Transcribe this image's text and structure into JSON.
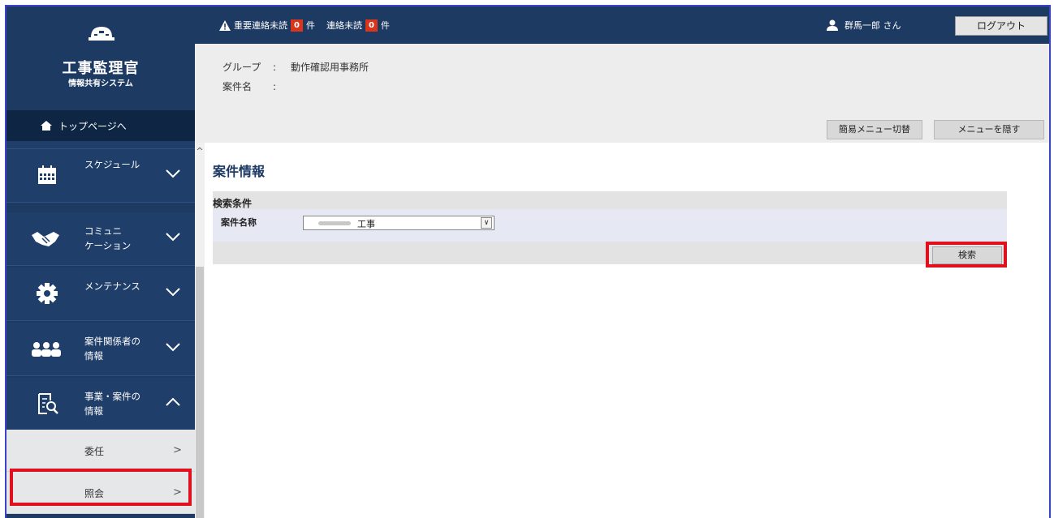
{
  "app": {
    "title": "工事監理官",
    "subtitle": "情報共有システム"
  },
  "sidebar": {
    "top_link": "トップページへ",
    "items": [
      {
        "label": "スケジュール"
      },
      {
        "label": "コミュニ\nケーション"
      },
      {
        "label": "メンテナンス"
      },
      {
        "label": "案件関係者の\n情報"
      },
      {
        "label": "事業・案件の\n情報"
      }
    ],
    "sub_items": [
      {
        "label": "委任"
      },
      {
        "label": "照会"
      }
    ]
  },
  "header": {
    "important_unread_label": "重要連絡未読",
    "important_unread_count": "0",
    "count_unit": "件",
    "unread_label": "連絡未読",
    "unread_count": "0",
    "user_name": "群馬一郎 さん",
    "logout": "ログアウト"
  },
  "info": {
    "group_label": "グループ",
    "group_value": "動作確認用事務所",
    "project_label": "案件名",
    "colon": ":",
    "simple_menu_button": "簡易メニュー切替",
    "hide_menu_button": "メニューを隠す"
  },
  "main": {
    "page_title": "案件情報",
    "search_conditions": "検索条件",
    "project_name_label": "案件名称",
    "project_name_value": "工事",
    "search_button": "検索"
  },
  "colors": {
    "navy": "#1d3a63",
    "badge_red": "#d9341c",
    "highlight_red": "#e0101e"
  }
}
